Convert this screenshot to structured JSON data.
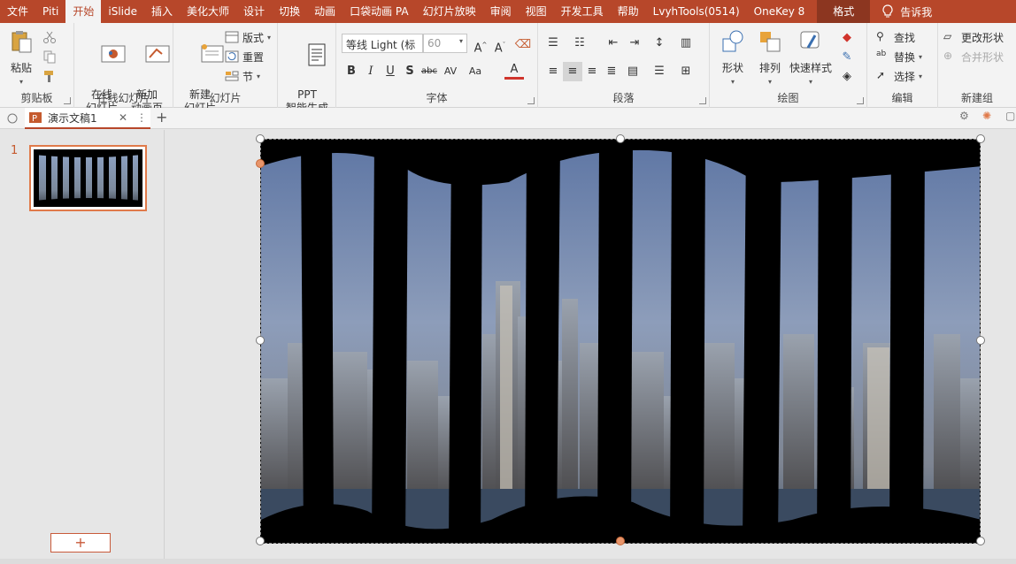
{
  "tabs": [
    "文件",
    "Piti",
    "开始",
    "iSlide",
    "插入",
    "美化大师",
    "设计",
    "切换",
    "动画",
    "口袋动画 PA",
    "幻灯片放映",
    "审阅",
    "视图",
    "开发工具",
    "帮助",
    "LvyhTools(0514)",
    "OneKey 8"
  ],
  "active_tab": "开始",
  "format_tab": "格式",
  "tell_me": "告诉我",
  "ribbon": {
    "clipboard": {
      "label": "剪贴板",
      "paste": "粘贴"
    },
    "online_slides": {
      "label": "在线幻灯片",
      "online": "在线\n幻灯片",
      "new_anim": "新加\n动画页"
    },
    "slides": {
      "label": "幻灯片",
      "new_slide": "新建\n幻灯片",
      "layout": "版式",
      "reset": "重置",
      "section": "节"
    },
    "ppt": {
      "label": "PPT\n智能生成"
    },
    "font": {
      "label": "字体",
      "font_name": "等线 Light (标",
      "font_size": "60"
    },
    "paragraph": {
      "label": "段落"
    },
    "drawing": {
      "label": "绘图",
      "shape": "形状",
      "arrange": "排列",
      "quick_styles": "快速样式"
    },
    "editing": {
      "label": "编辑",
      "find": "查找",
      "replace": "替换",
      "select": "选择"
    },
    "new_group": {
      "label": "新建组",
      "change_shape": "更改形状",
      "merge_shapes": "合并形状"
    }
  },
  "doc_tab": {
    "title": "演示文稿1"
  },
  "thumbnails": [
    {
      "number": "1"
    }
  ],
  "add_slide": "+",
  "colors": {
    "accent": "#b7472a",
    "selection": "#e07a4a"
  }
}
